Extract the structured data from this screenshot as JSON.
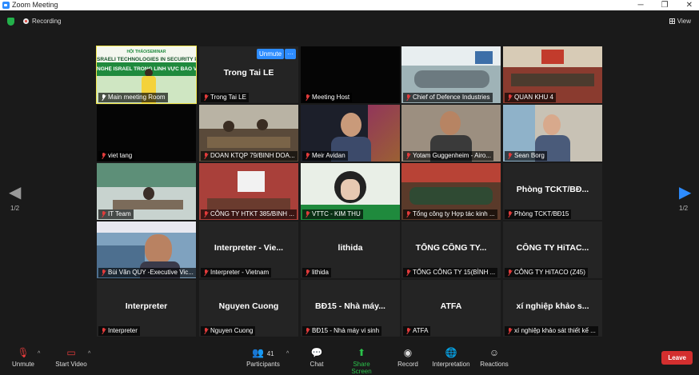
{
  "window": {
    "title": "Zoom Meeting",
    "controls": [
      "─",
      "❐",
      "✕"
    ]
  },
  "infobar": {
    "recording": "Recording",
    "view": "View"
  },
  "pagination": {
    "left": "1/2",
    "right": "1/2"
  },
  "unmute_button": "Unmute",
  "more_button": "···",
  "tiles": [
    {
      "name": "Main meeting Room",
      "title": "",
      "video": true,
      "pinned": true
    },
    {
      "name": "Trong Tai LE",
      "title": "Trong Tai LE",
      "video": false
    },
    {
      "name": "Meeting Host",
      "title": "",
      "video": false
    },
    {
      "name": "Chief of Defence Industries",
      "title": "",
      "video": true
    },
    {
      "name": "QUAN KHU 4",
      "title": "",
      "video": true
    },
    {
      "name": "viet tang",
      "title": "",
      "video": false
    },
    {
      "name": "DOAN KTQP 79/BINH DOA...",
      "title": "",
      "video": true
    },
    {
      "name": "Meir Avidan",
      "title": "",
      "video": true
    },
    {
      "name": "Yotam Guggenheim - Airo...",
      "title": "",
      "video": true
    },
    {
      "name": "Sean Borg",
      "title": "",
      "video": true
    },
    {
      "name": "IT Team",
      "title": "",
      "video": true
    },
    {
      "name": "CÔNG TY HTKT 385/BINH ...",
      "title": "",
      "video": true
    },
    {
      "name": "VTTC - KIM THU",
      "title": "",
      "video": true
    },
    {
      "name": "Tổng công ty Hợp tác kinh ...",
      "title": "",
      "video": true
    },
    {
      "name": "Phòng TCKT/BĐ15",
      "title": "Phòng TCKT/BĐ...",
      "video": false
    },
    {
      "name": "Bùi Văn QUY -Executive Vic...",
      "title": "",
      "video": true
    },
    {
      "name": "Interpreter - Vietnam",
      "title": "Interpreter - Vie...",
      "video": false
    },
    {
      "name": "lithida",
      "title": "lithida",
      "video": false
    },
    {
      "name": "TỔNG CÔNG TY 15(BÌNH ...",
      "title": "TỔNG CÔNG TY...",
      "video": false
    },
    {
      "name": "CÔNG TY HiTACO (Z45)",
      "title": "CÔNG TY HiTAC...",
      "video": false
    },
    {
      "name": "Interpreter",
      "title": "Interpreter",
      "video": false
    },
    {
      "name": "Nguyen Cuong",
      "title": "Nguyen Cuong",
      "video": false
    },
    {
      "name": "BĐ15 - Nhà máy vi sinh",
      "title": "BĐ15 - Nhà máy...",
      "video": false
    },
    {
      "name": "ATFA",
      "title": "ATFA",
      "video": false
    },
    {
      "name": "xí nghiệp khảo sát thiết kế ...",
      "title": "xí nghiệp khảo s...",
      "video": false
    }
  ],
  "banner": {
    "line1": "HỘI THẢO/SEMINAR",
    "line2": "SRAELI TECHNOLOGIES IN SECURITY PROTEC",
    "line3": "NGHỆ ISRAEL TRONG LĨNH VỰC BẢO VỆ AN NI"
  },
  "toolbar": {
    "unmute": "Unmute",
    "start_video": "Start Video",
    "participants": "Participants",
    "participants_count": "41",
    "chat": "Chat",
    "share_screen": "Share Screen",
    "record": "Record",
    "interpretation": "Interpretation",
    "reactions": "Reactions",
    "leave": "Leave"
  },
  "colors": {
    "accent": "#2d8cff",
    "share": "#2bc24b",
    "leave": "#d32f2f",
    "active_speaker": "#f0e44a"
  }
}
